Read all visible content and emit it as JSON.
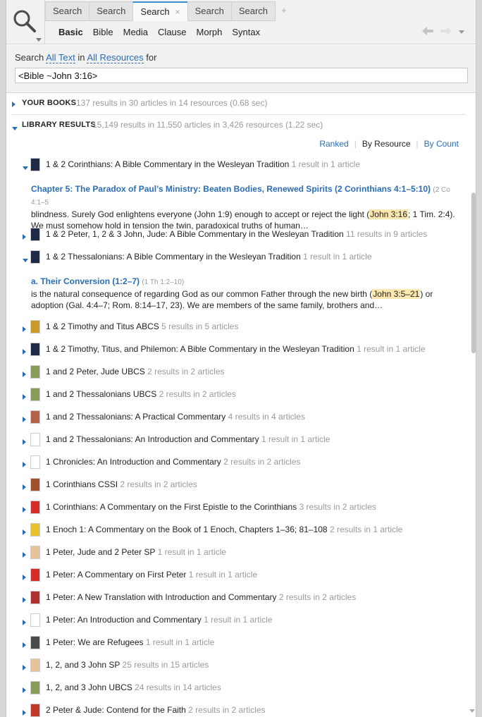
{
  "tabs": [
    "Search",
    "Search",
    "Search",
    "Search",
    "Search"
  ],
  "tab_close_icon": "×",
  "tab_add_icon": "+",
  "subtabs": [
    "Basic",
    "Bible",
    "Media",
    "Clause",
    "Morph",
    "Syntax"
  ],
  "query": {
    "prefix": "Search",
    "scope": "All Text",
    "in_text": "in",
    "resources": "All Resources",
    "suffix": "for",
    "value": "<Bible ~John 3:16>"
  },
  "your_books": {
    "title": "YOUR BOOKS",
    "count": "137 results in 30 articles in 14 resources (0.68 sec)"
  },
  "library": {
    "title": "LIBRARY RESULTS",
    "count": "15,149 results in 11,550 articles in 3,426 resources (1.22 sec)"
  },
  "sort": {
    "ranked": "Ranked",
    "by_resource": "By Resource",
    "by_count": "By Count"
  },
  "rows": [
    {
      "title": "1 & 2 Corinthians: A Bible Commentary in the Wesleyan Tradition",
      "results": "1 result in 1 article",
      "expanded": true,
      "color": "#1f2a44"
    },
    {
      "title": "1 & 2 Peter, 1, 2 & 3 John, Jude: A Bible Commentary in the Wesleyan Tradition",
      "results": "11 results in 9 articles",
      "expanded": false,
      "color": "#1f2a44"
    },
    {
      "title": "1 & 2 Thessalonians: A Bible Commentary in the Wesleyan Tradition",
      "results": "1 result in 1 article",
      "expanded": true,
      "color": "#1f2a44"
    },
    {
      "title": "1 & 2 Timothy and Titus ABCS",
      "results": "5 results in 5 articles",
      "expanded": false,
      "color": "#c89a2a"
    },
    {
      "title": "1 & 2 Timothy, Titus, and Philemon: A Bible Commentary in the Wesleyan Tradition",
      "results": "1 result in 1 article",
      "expanded": false,
      "color": "#1f2a44"
    },
    {
      "title": "1 and 2 Peter, Jude UBCS",
      "results": "2 results in 2 articles",
      "expanded": false,
      "color": "#8a9a5a"
    },
    {
      "title": "1 and 2 Thessalonians UBCS",
      "results": "2 results in 2 articles",
      "expanded": false,
      "color": "#8a9a5a"
    },
    {
      "title": "1 and 2 Thessalonians: A Practical Commentary",
      "results": "4 results in 4 articles",
      "expanded": false,
      "color": "#b5604a"
    },
    {
      "title": "1 and 2 Thessalonians: An Introduction and Commentary",
      "results": "1 result in 1 article",
      "expanded": false,
      "color": "#ffffff"
    },
    {
      "title": "1 Chronicles: An Introduction and Commentary",
      "results": "2 results in 2 articles",
      "expanded": false,
      "color": "#ffffff"
    },
    {
      "title": "1 Corinthians CSSI",
      "results": "2 results in 2 articles",
      "expanded": false,
      "color": "#a0522d"
    },
    {
      "title": "1 Corinthians: A Commentary on the First Epistle to the Corinthians",
      "results": "3 results in 2 articles",
      "expanded": false,
      "color": "#d62b2b"
    },
    {
      "title": "1 Enoch 1: A Commentary on the Book of 1 Enoch, Chapters 1–36; 81–108",
      "results": "2 results in 1 article",
      "expanded": false,
      "color": "#e8c22a"
    },
    {
      "title": "1 Peter, Jude and 2 Peter SP",
      "results": "1 result in 1 article",
      "expanded": false,
      "color": "#e6c49a"
    },
    {
      "title": "1 Peter: A Commentary on First Peter",
      "results": "1 result in 1 article",
      "expanded": false,
      "color": "#d62b2b"
    },
    {
      "title": "1 Peter: A New Translation with Introduction and Commentary",
      "results": "2 results in 2 articles",
      "expanded": false,
      "color": "#b03030"
    },
    {
      "title": "1 Peter: An Introduction and Commentary",
      "results": "1 result in 1 article",
      "expanded": false,
      "color": "#ffffff"
    },
    {
      "title": "1 Peter: We are Refugees",
      "results": "1 result in 1 article",
      "expanded": false,
      "color": "#4a4a4a"
    },
    {
      "title": "1, 2, and 3 John SP",
      "results": "25 results in 15 articles",
      "expanded": false,
      "color": "#e6c49a"
    },
    {
      "title": "1, 2, and 3 John UBCS",
      "results": "24 results in 14 articles",
      "expanded": false,
      "color": "#8a9a5a"
    },
    {
      "title": "2 Peter & Jude: Contend for the Faith",
      "results": "2 results in 2 articles",
      "expanded": false,
      "color": "#c0392b"
    }
  ],
  "snippet1": {
    "heading": "Chapter 5: The Paradox of Paul’s Ministry: Beaten Bodies, Renewed Spirits (2 Corinthians 4:1–5:10)",
    "heading_ref": "(2 Co 4:1–5",
    "line1_a": "blindness. Surely God enlightens everyone (John 1:9) enough to accept or reject the light (",
    "line1_hl": "John 3:16",
    "line1_b": "; 1 Tim. 2:4).",
    "line2": "We must somehow hold in tension the twin, paradoxical truths of human…"
  },
  "snippet2": {
    "heading": "a. Their Conversion (1:2–7)",
    "heading_ref": "(1 Th 1:2–10)",
    "line1_a": "is the natural consequence of regarding God as our common Father through the new birth (",
    "line1_hl": "John 3:5–21",
    "line1_b": ") or",
    "line2": "adoption (Gal. 4:4–7; Rom. 8:14–17, 23). We are members of the same family, brothers and…"
  }
}
